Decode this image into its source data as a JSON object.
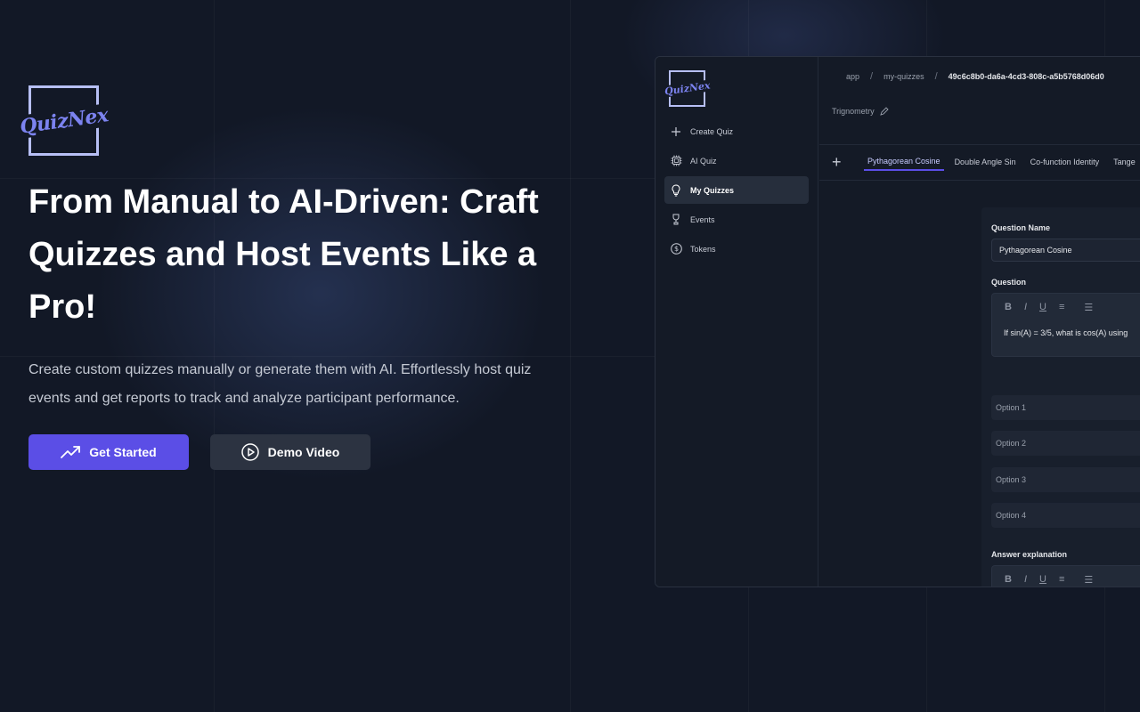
{
  "brand": {
    "logo_text": "QuizNex",
    "accent_color": "#5b4ee6",
    "logo_color": "#7c83f0"
  },
  "hero": {
    "title": "From Manual to AI-Driven: Craft Quizzes and Host Events Like a Pro!",
    "subtitle": "Create custom quizzes manually or generate them with AI. Effortlessly host quiz events and get reports to track and analyze participant performance.",
    "primary_button": "Get Started",
    "secondary_button": "Demo Video"
  },
  "app": {
    "sidebar": {
      "items": [
        {
          "label": "Create Quiz",
          "icon": "plus-icon"
        },
        {
          "label": "AI Quiz",
          "icon": "chip-icon"
        },
        {
          "label": "My Quizzes",
          "icon": "lightbulb-icon",
          "active": true
        },
        {
          "label": "Events",
          "icon": "trophy-icon"
        },
        {
          "label": "Tokens",
          "icon": "dollar-icon"
        }
      ]
    },
    "breadcrumb": [
      "app",
      "my-quizzes",
      "49c6c8b0-da6a-4cd3-808c-a5b5768d06d0"
    ],
    "subject": "Trignometry",
    "tabs": [
      "Pythagorean Cosine",
      "Double Angle Sin",
      "Co-function Identity",
      "Tange"
    ],
    "editor": {
      "question_name_label": "Question Name",
      "question_name_value": "Pythagorean Cosine",
      "question_label": "Question",
      "question_text": "If sin(A) = 3/5, what is cos(A) using",
      "options": [
        "Option 1",
        "Option 2",
        "Option 3",
        "Option 4"
      ],
      "explanation_label": "Answer explanation"
    }
  }
}
